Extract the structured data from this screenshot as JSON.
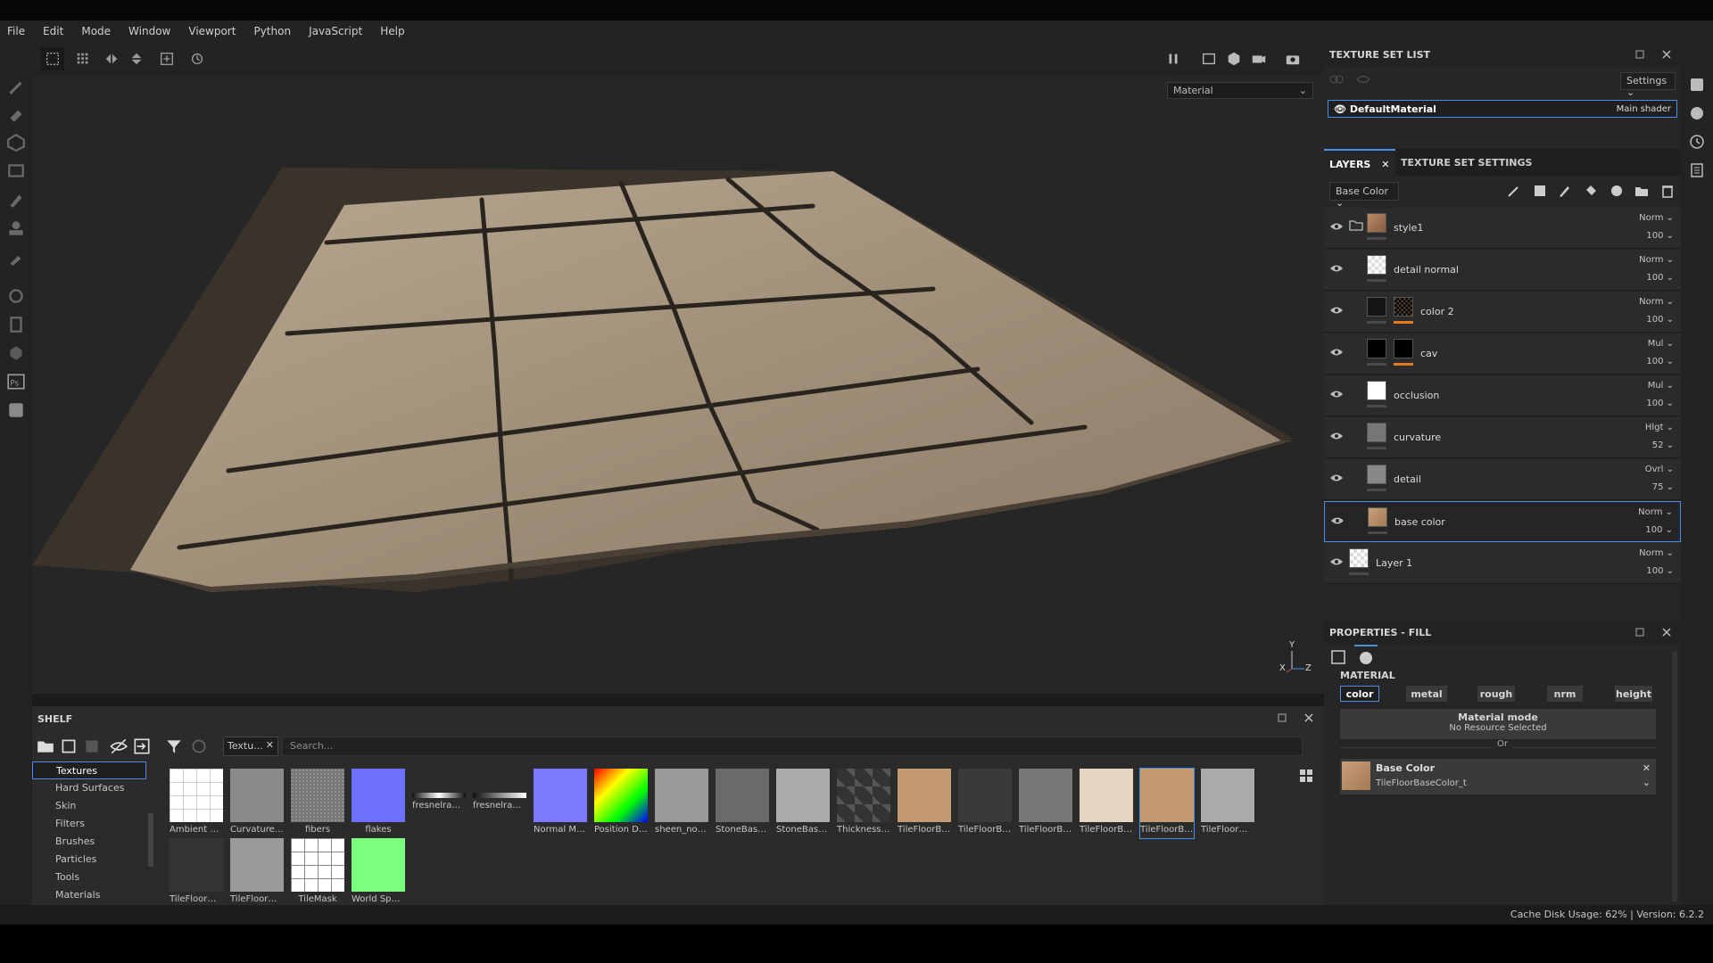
{
  "menu": [
    "File",
    "Edit",
    "Mode",
    "Window",
    "Viewport",
    "Python",
    "JavaScript",
    "Help"
  ],
  "viewport": {
    "mode_dropdown": "Material",
    "axis_y": "Y",
    "axis_x": "X",
    "axis_z": "Z"
  },
  "shelf": {
    "title": "SHELF",
    "categories": [
      "Textures",
      "Hard Surfaces",
      "Skin",
      "Filters",
      "Brushes",
      "Particles",
      "Tools",
      "Materials"
    ],
    "filter_chip": "Textu...",
    "search_placeholder": "Search...",
    "items": [
      "Ambient O...",
      "Curvature ...",
      "fibers",
      "flakes",
      "fresnelranges",
      "fresnelrang...",
      "Normal Ma...",
      "Position De...",
      "sheen_noise",
      "StoneBaseT...",
      "StoneBaseT...",
      "Thickness ...",
      "TileFloorBas...",
      "TileFloorBas...",
      "TileFloorBas...",
      "TileFloorBas...",
      "TileFloorBas...",
      "TileFloorDet...",
      "TileFloorDet...",
      "TileFloorDet...",
      "TileMask",
      "World Spac..."
    ]
  },
  "texture_set": {
    "title": "TEXTURE SET LIST",
    "settings_label": "Settings",
    "material_name": "DefaultMaterial",
    "shader": "Main shader"
  },
  "layers_panel": {
    "tab_layers": "LAYERS",
    "tab_settings": "TEXTURE SET SETTINGS",
    "channel_dropdown": "Base Color",
    "layers": [
      {
        "name": "style1",
        "blend": "Norm",
        "opacity": "100"
      },
      {
        "name": "detail normal",
        "blend": "Norm",
        "opacity": "100"
      },
      {
        "name": "color 2",
        "blend": "Norm",
        "opacity": "100"
      },
      {
        "name": "cav",
        "blend": "Mul",
        "opacity": "100"
      },
      {
        "name": "occlusion",
        "blend": "Mul",
        "opacity": "100"
      },
      {
        "name": "curvature",
        "blend": "Hlgt",
        "opacity": "52"
      },
      {
        "name": "detail",
        "blend": "Ovrl",
        "opacity": "75"
      },
      {
        "name": "base color",
        "blend": "Norm",
        "opacity": "100"
      },
      {
        "name": "Layer 1",
        "blend": "Norm",
        "opacity": "100"
      }
    ]
  },
  "properties": {
    "title": "PROPERTIES - FILL",
    "section": "MATERIAL",
    "channels": [
      "color",
      "metal",
      "rough",
      "nrm",
      "height"
    ],
    "material_mode_title": "Material mode",
    "material_mode_value": "No Resource Selected",
    "or_label": "Or",
    "base_color_label": "Base Color",
    "base_color_resource": "TileFloorBaseColor_t"
  },
  "status": {
    "cache": "Cache Disk Usage:",
    "cache_value": "62%",
    "version": "| Version: 6.2.2"
  },
  "colors": {
    "accent": "#4a90e2",
    "orange_mask": "#e07a1e",
    "panel_bg": "#262626"
  }
}
